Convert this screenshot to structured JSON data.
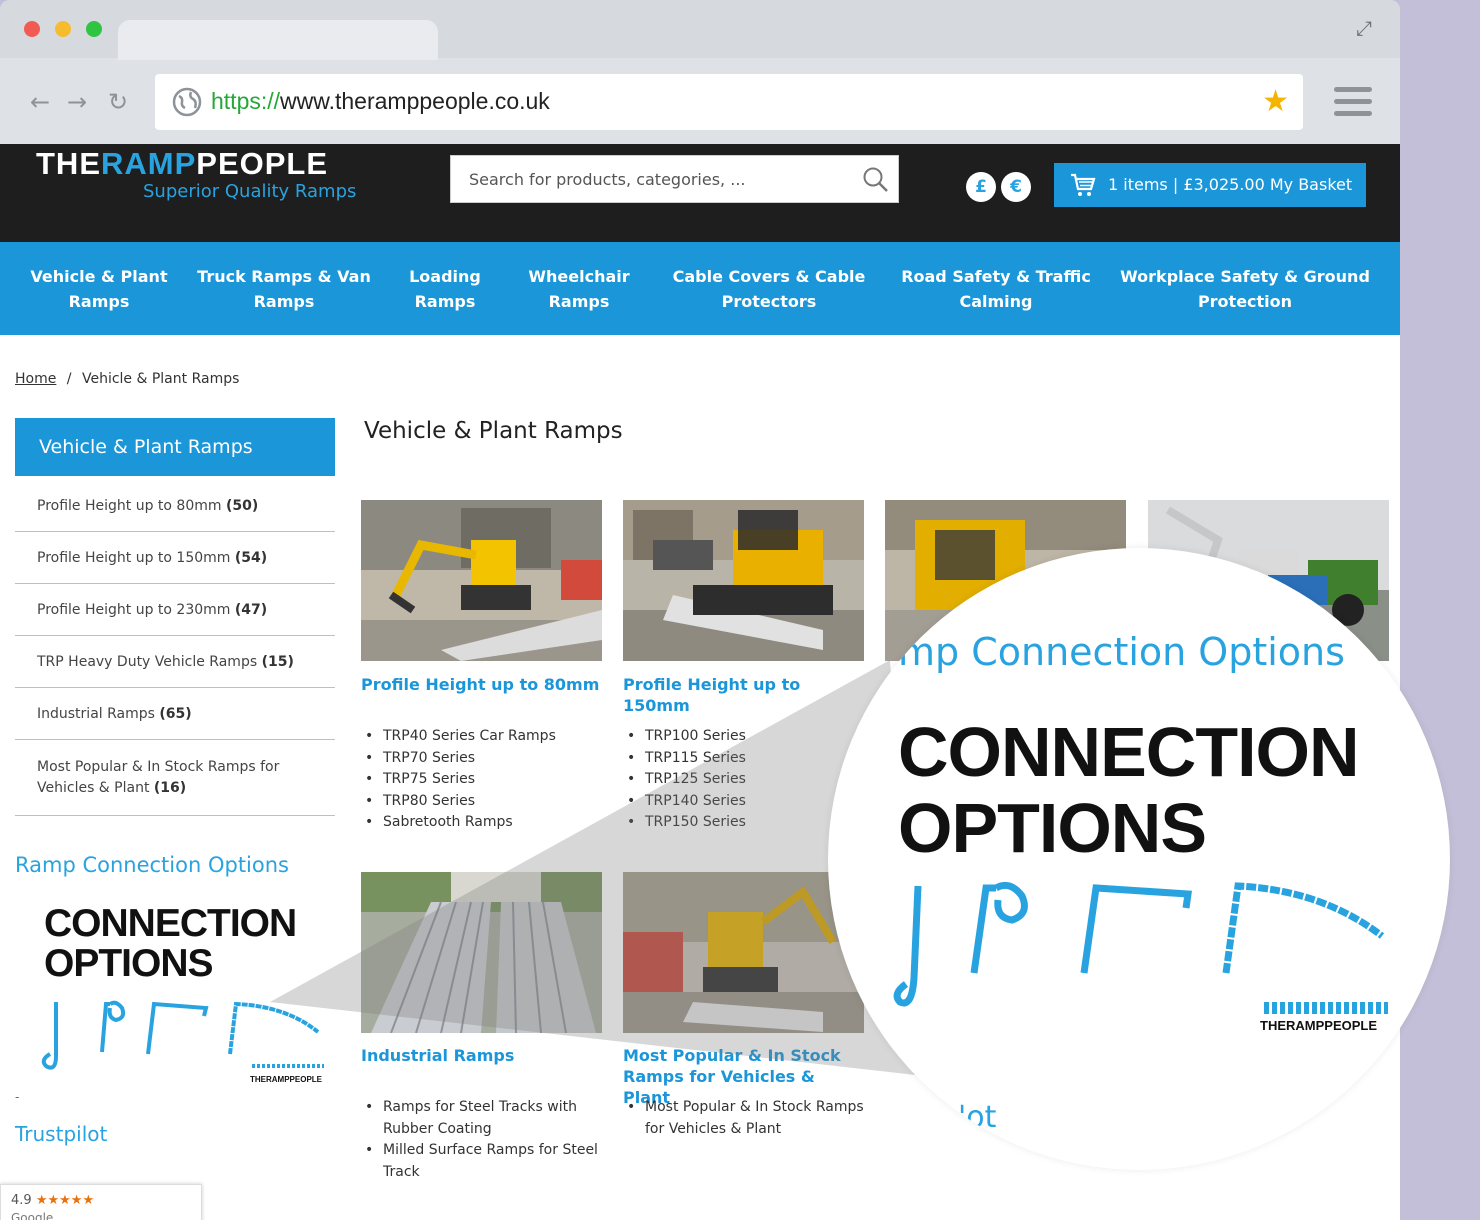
{
  "browser": {
    "url_scheme": "https://",
    "url_rest": "www.theramppeople.co.uk"
  },
  "header": {
    "logo_part1": "THE",
    "logo_part2": "RAMP",
    "logo_part3": "PEOPLE",
    "tagline": "Superior Quality Ramps",
    "search_placeholder": "Search for products, categories, ...",
    "currency_gbp": "£",
    "currency_eur": "€",
    "basket_items": "1 items | £3,025.00",
    "basket_label": "My Basket"
  },
  "nav": {
    "items": [
      {
        "line1": "Vehicle & Plant",
        "line2": "Ramps"
      },
      {
        "line1": "Truck Ramps & Van",
        "line2": "Ramps"
      },
      {
        "line1": "Loading",
        "line2": "Ramps"
      },
      {
        "line1": "Wheelchair",
        "line2": "Ramps"
      },
      {
        "line1": "Cable Covers & Cable",
        "line2": "Protectors"
      },
      {
        "line1": "Road Safety & Traffic",
        "line2": "Calming"
      },
      {
        "line1": "Workplace Safety & Ground",
        "line2": "Protection"
      }
    ]
  },
  "breadcrumb": {
    "home": "Home",
    "separator": "/",
    "current": "Vehicle & Plant Ramps"
  },
  "sidebar": {
    "heading": "Vehicle & Plant Ramps",
    "items": [
      {
        "label": "Profile Height up to 80mm",
        "count": "(50)"
      },
      {
        "label": "Profile Height up to 150mm",
        "count": "(54)"
      },
      {
        "label": "Profile Height up to 230mm",
        "count": "(47)"
      },
      {
        "label": "TRP Heavy Duty Vehicle Ramps",
        "count": "(15)"
      },
      {
        "label": "Industrial Ramps",
        "count": "(65)"
      },
      {
        "label": "Most Popular & In Stock Ramps for Vehicles & Plant",
        "count": "(16)"
      }
    ],
    "connection_title": "Ramp Connection Options",
    "connection_line1": "CONNECTION",
    "connection_line2": "OPTIONS",
    "connection_logo": "THERAMPPEOPLE",
    "dash": "-",
    "trustpilot": "Trustpilot",
    "review_score": "4.9",
    "review_stars": "★★★★★",
    "review_source": "Google"
  },
  "main": {
    "title": "Vehicle & Plant Ramps",
    "cards": [
      {
        "title": "Profile Height up to 80mm",
        "items": [
          "TRP40 Series Car Ramps",
          "TRP70 Series",
          "TRP75 Series",
          "TRP80 Series",
          "Sabretooth Ramps"
        ]
      },
      {
        "title": "Profile Height up to 150mm",
        "items": [
          "TRP100 Series",
          "TRP115 Series",
          "TRP125 Series",
          "TRP140 Series",
          "TRP150 Series"
        ]
      },
      {
        "title": "Industrial Ramps",
        "items": [
          "Ramps for Steel Tracks with Rubber Coating",
          "Milled Surface Ramps for Steel Track"
        ]
      },
      {
        "title": "Most Popular & In Stock Ramps for Vehicles & Plant",
        "items": [
          "Most Popular & In Stock Ramps for Vehicles & Plant"
        ]
      }
    ]
  },
  "magnifier": {
    "title": "mp Connection Options",
    "line1": "CONNECTION",
    "line2": "OPTIONS",
    "logo": "THERAMPPEOPLE",
    "trust_fragment": "'ot"
  },
  "colors": {
    "brand_blue": "#1b96d8",
    "header_dark": "#1e1e1e",
    "link_blue": "#29a3e0"
  }
}
